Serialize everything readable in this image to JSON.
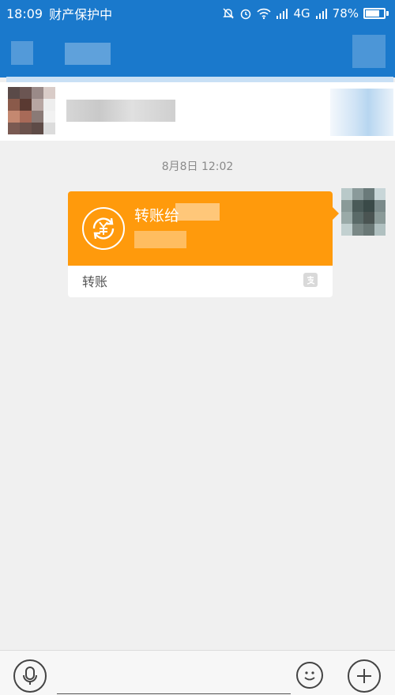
{
  "status_bar": {
    "time": "18:09",
    "notification_text": "财产保护中",
    "network": "4G",
    "battery_percent": "78%",
    "battery_level": 0.78
  },
  "chat": {
    "timestamp": "8月8日 12:02",
    "message": {
      "title": "转账给",
      "footer_label": "转账",
      "icon": "yuan-transfer-icon"
    }
  },
  "colors": {
    "primary": "#1a79cc",
    "transfer_orange": "#ff9a0c",
    "background": "#f0f0f0"
  },
  "icons": {
    "voice": "microphone-icon",
    "emoji": "emoji-icon",
    "more": "plus-icon",
    "brand": "alipay-icon"
  }
}
